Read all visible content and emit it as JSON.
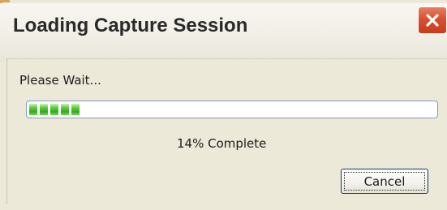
{
  "window": {
    "title": "Loading Capture Session",
    "close_icon": "close-icon"
  },
  "content": {
    "message": "Please Wait...",
    "progress_percent": 14,
    "progress_text": "14% Complete"
  },
  "actions": {
    "cancel_label": "Cancel"
  },
  "colors": {
    "dialog_bg": "#ece9d8",
    "progress_green": "#2fae18",
    "close_red": "#d8512f",
    "button_border": "#003c74"
  }
}
